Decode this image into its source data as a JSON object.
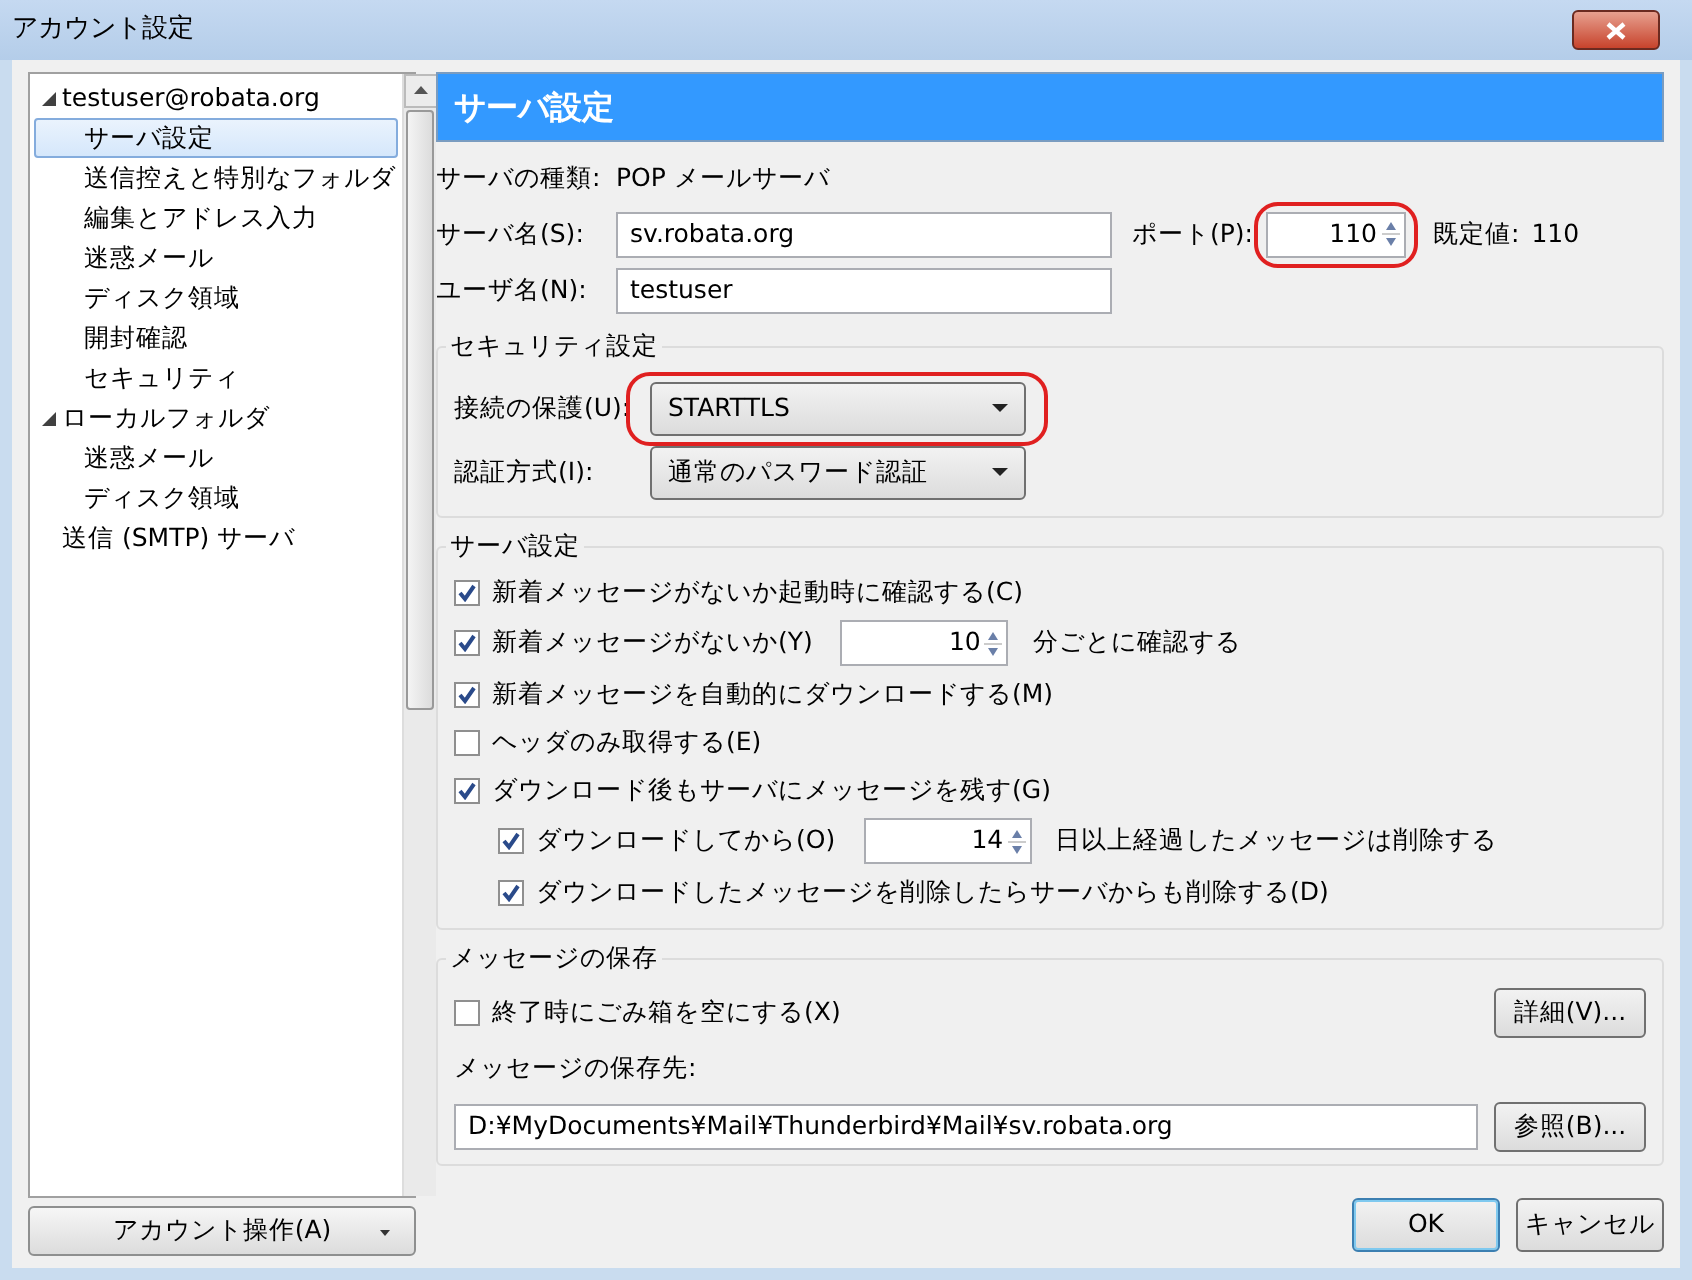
{
  "window": {
    "title": "アカウント設定"
  },
  "sidebar": {
    "items": [
      {
        "label": "testuser@robata.org",
        "expanded": true,
        "selected": false,
        "children": [
          {
            "label": "サーバ設定",
            "selected": true
          },
          {
            "label": "送信控えと特別なフォルダ",
            "selected": false
          },
          {
            "label": "編集とアドレス入力",
            "selected": false
          },
          {
            "label": "迷惑メール",
            "selected": false
          },
          {
            "label": "ディスク領域",
            "selected": false
          },
          {
            "label": "開封確認",
            "selected": false
          },
          {
            "label": "セキュリティ",
            "selected": false
          }
        ]
      },
      {
        "label": "ローカルフォルダ",
        "expanded": true,
        "selected": false,
        "children": [
          {
            "label": "迷惑メール",
            "selected": false
          },
          {
            "label": "ディスク領域",
            "selected": false
          }
        ]
      },
      {
        "label": "送信 (SMTP) サーバ",
        "selected": false
      }
    ],
    "account_button": "アカウント操作(A)"
  },
  "panel": {
    "header": "サーバ設定",
    "server_type": {
      "label": "サーバの種類:",
      "value": "POP メールサーバ"
    },
    "server_name": {
      "label": "サーバ名(S):",
      "value": "sv.robata.org"
    },
    "port": {
      "label": "ポート(P):",
      "value": "110",
      "highlighted": true
    },
    "default_port": {
      "label": "既定値:",
      "value": "110"
    },
    "user_name": {
      "label": "ユーザ名(N):",
      "value": "testuser"
    },
    "security": {
      "title": "セキュリティ設定",
      "connection": {
        "label": "接続の保護(U):",
        "value": "STARTTLS",
        "highlighted": true
      },
      "auth": {
        "label": "認証方式(I):",
        "value": "通常のパスワード認証",
        "highlighted": false
      }
    },
    "server_settings": {
      "title": "サーバ設定",
      "options": [
        {
          "kind": "check",
          "label": "新着メッセージがないか起動時に確認する(C)",
          "checked": true
        },
        {
          "kind": "number",
          "label": "新着メッセージがないか(Y)",
          "checked": true,
          "value": "10",
          "suffix": "分ごとに確認する"
        },
        {
          "kind": "check",
          "label": "新着メッセージを自動的にダウンロードする(M)",
          "checked": true
        },
        {
          "kind": "check",
          "label": "ヘッダのみ取得する(E)",
          "checked": false
        },
        {
          "kind": "check",
          "label": "ダウンロード後もサーバにメッセージを残す(G)",
          "checked": true,
          "children": [
            {
              "kind": "number",
              "label": "ダウンロードしてから(O)",
              "checked": true,
              "value": "14",
              "suffix": "日以上経過したメッセージは削除する"
            },
            {
              "kind": "check",
              "label": "ダウンロードしたメッセージを削除したらサーバからも削除する(D)",
              "checked": true
            }
          ]
        }
      ]
    },
    "storage": {
      "title": "メッセージの保存",
      "empty_trash": {
        "label": "終了時にごみ箱を空にする(X)",
        "checked": false
      },
      "details_button": "詳細(V)...",
      "location_label": "メッセージの保存先:",
      "path": "D:¥MyDocuments¥Mail¥Thunderbird¥Mail¥sv.robata.org",
      "browse_button": "参照(B)..."
    }
  },
  "buttons": [
    {
      "label": "OK",
      "focused": true
    },
    {
      "label": "キャンセル",
      "focused": false
    }
  ]
}
